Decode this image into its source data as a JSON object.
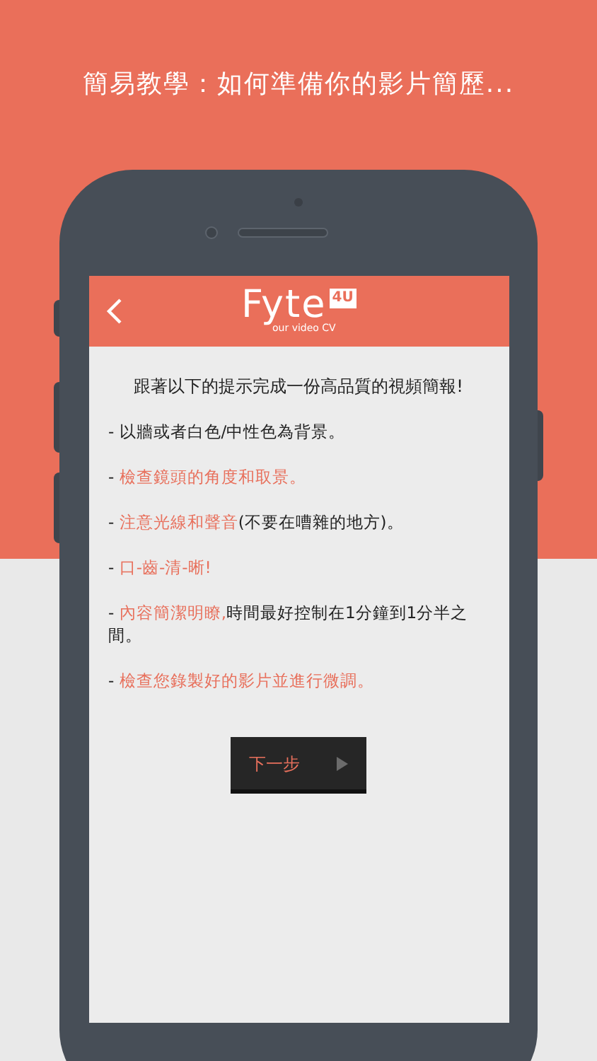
{
  "headline": "簡易教學：如何準備你的影片簡歷...",
  "header": {
    "logo": {
      "word": "Fyte",
      "badge": "4U",
      "tagline": "our video CV"
    }
  },
  "intro": "跟著以下的提示完成一份高品質的視頻簡報!",
  "tips": [
    {
      "segments": [
        {
          "text": "- 以牆或者白色/中性色為背景。",
          "highlighted": false
        }
      ]
    },
    {
      "segments": [
        {
          "text": "- ",
          "highlighted": false
        },
        {
          "text": "檢查鏡頭的角度和取景。",
          "highlighted": true
        }
      ]
    },
    {
      "segments": [
        {
          "text": "- ",
          "highlighted": false
        },
        {
          "text": "注意光線和聲音",
          "highlighted": true
        },
        {
          "text": "(不要在嘈雜的地方)。",
          "highlighted": false
        }
      ]
    },
    {
      "segments": [
        {
          "text": "- ",
          "highlighted": false
        },
        {
          "text": "口-齒-清-晰!",
          "highlighted": true
        }
      ]
    },
    {
      "segments": [
        {
          "text": "- ",
          "highlighted": false
        },
        {
          "text": "內容簡潔明瞭,",
          "highlighted": true
        },
        {
          "text": "時間最好控制在1分鐘到1分半之間。",
          "highlighted": false
        }
      ]
    },
    {
      "segments": [
        {
          "text": "- ",
          "highlighted": false
        },
        {
          "text": "檢查您錄製好的影片並進行微調。",
          "highlighted": true
        }
      ]
    }
  ],
  "next_button": {
    "label": "下一步"
  }
}
